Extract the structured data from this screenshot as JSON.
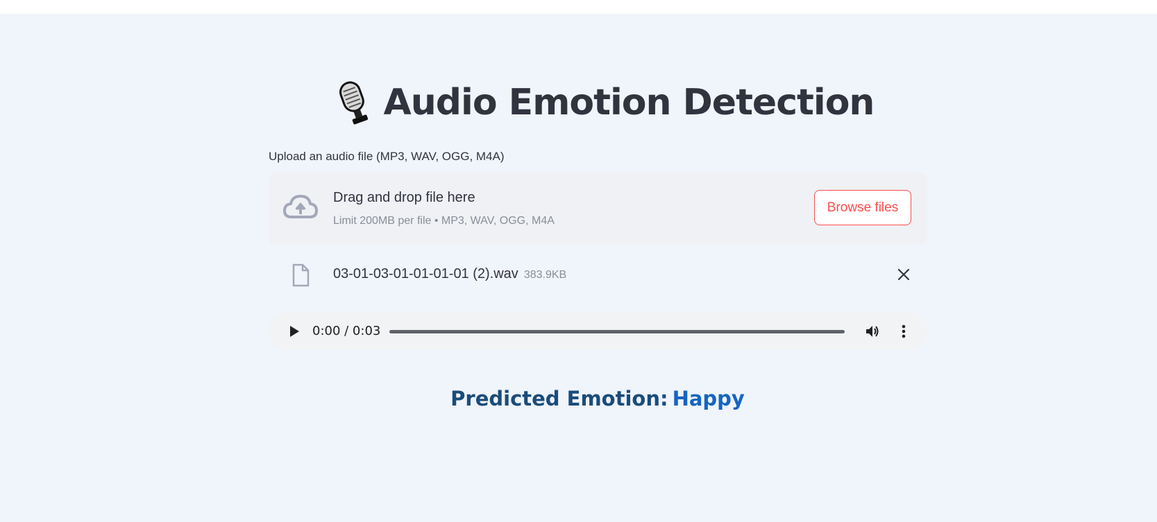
{
  "header": {
    "title": "Audio Emotion Detection",
    "icon": "microphone-icon"
  },
  "uploader": {
    "label": "Upload an audio file (MP3, WAV, OGG, M4A)",
    "drop_title": "Drag and drop file here",
    "drop_hint": "Limit 200MB per file • MP3, WAV, OGG, M4A",
    "browse_label": "Browse files",
    "icon": "cloud-upload-icon",
    "accent_color": "#ff4b4b"
  },
  "file": {
    "name": "03-01-03-01-01-01-01 (2).wav",
    "size": "383.9KB",
    "icon": "file-icon",
    "remove_icon": "close-icon"
  },
  "player": {
    "time": "0:00 / 0:03",
    "progress": 0,
    "icons": [
      "play-icon",
      "volume-icon",
      "more-vert-icon"
    ]
  },
  "result": {
    "label": "Predicted Emotion:",
    "value": "Happy",
    "label_color": "#1a4c7a",
    "value_color": "#1565c0"
  }
}
